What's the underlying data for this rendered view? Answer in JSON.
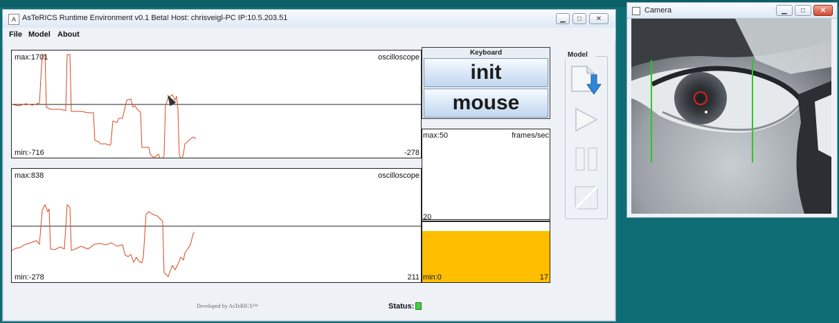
{
  "main_window": {
    "title": "AsTeRICS Runtime Environment  v0.1 Beta! Host: chrisveigl-PC  IP:10.5.203.51",
    "menu": [
      "File",
      "Model",
      "About"
    ],
    "window_buttons": {
      "minimize": "▁",
      "maximize": "□",
      "close": "✕"
    }
  },
  "oscilloscope1": {
    "max": "max:1701",
    "min": "min:-716",
    "type": "oscilloscope",
    "current": "-278"
  },
  "oscilloscope2": {
    "max": "max:838",
    "min": "min:-278",
    "type": "oscilloscope",
    "current": "211"
  },
  "keyboard": {
    "title": "Keyboard",
    "buttons": [
      "init",
      "mouse"
    ]
  },
  "fps_panel": {
    "max": "max:50",
    "label": "frames/sec",
    "value": "20"
  },
  "bar_panel": {
    "min": "min:0",
    "value": "17",
    "level": 0.85,
    "color": "#ffbf00"
  },
  "model_panel": {
    "title": "Model",
    "icons": [
      "deploy-model-icon",
      "play-icon",
      "pause-icon",
      "stop-icon"
    ]
  },
  "footer": {
    "developed_by": "Developed by AsTeRICS™",
    "status_label": "Status:",
    "status_color": "#3fd13f"
  },
  "camera_window": {
    "title": "Camera",
    "window_buttons": {
      "minimize": "▁",
      "maximize": "□",
      "close": "✕"
    }
  },
  "colors": {
    "desktop": "#0e6d74",
    "trace": "#d9461e",
    "bar": "#ffbf00"
  }
}
